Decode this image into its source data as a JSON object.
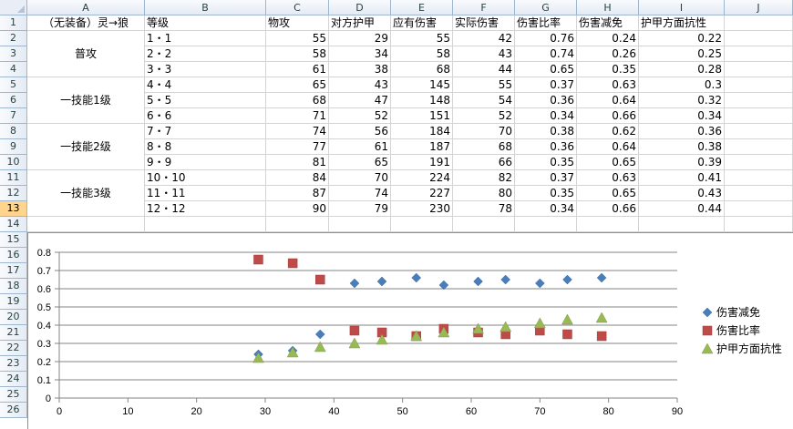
{
  "columns": [
    "A",
    "B",
    "C",
    "D",
    "E",
    "F",
    "G",
    "H",
    "I",
    "J"
  ],
  "rows": [
    "1",
    "2",
    "3",
    "4",
    "5",
    "6",
    "7",
    "8",
    "9",
    "10",
    "11",
    "12",
    "13",
    "14",
    "15",
    "16",
    "17",
    "18",
    "19",
    "20",
    "21",
    "22",
    "23",
    "24",
    "25",
    "26"
  ],
  "selected_row": "13",
  "header_row": [
    "（无装备）灵→狼",
    "等级",
    "物攻",
    "对方护甲",
    "应有伤害",
    "实际伤害",
    "伤害比率",
    "伤害减免",
    "护甲方面抗性"
  ],
  "groups": [
    "普攻",
    "一技能1级",
    "一技能2级",
    "一技能3级"
  ],
  "data_rows": [
    {
      "level": "1・1",
      "atk": "55",
      "armor": "29",
      "expected": "55",
      "actual": "42",
      "ratio": "0.76",
      "reduction": "0.24",
      "resist": "0.22"
    },
    {
      "level": "2・2",
      "atk": "58",
      "armor": "34",
      "expected": "58",
      "actual": "43",
      "ratio": "0.74",
      "reduction": "0.26",
      "resist": "0.25"
    },
    {
      "level": "3・3",
      "atk": "61",
      "armor": "38",
      "expected": "68",
      "actual": "44",
      "ratio": "0.65",
      "reduction": "0.35",
      "resist": "0.28"
    },
    {
      "level": "4・4",
      "atk": "65",
      "armor": "43",
      "expected": "145",
      "actual": "55",
      "ratio": "0.37",
      "reduction": "0.63",
      "resist": "0.3"
    },
    {
      "level": "5・5",
      "atk": "68",
      "armor": "47",
      "expected": "148",
      "actual": "54",
      "ratio": "0.36",
      "reduction": "0.64",
      "resist": "0.32"
    },
    {
      "level": "6・6",
      "atk": "71",
      "armor": "52",
      "expected": "151",
      "actual": "52",
      "ratio": "0.34",
      "reduction": "0.66",
      "resist": "0.34"
    },
    {
      "level": "7・7",
      "atk": "74",
      "armor": "56",
      "expected": "184",
      "actual": "70",
      "ratio": "0.38",
      "reduction": "0.62",
      "resist": "0.36"
    },
    {
      "level": "8・8",
      "atk": "77",
      "armor": "61",
      "expected": "187",
      "actual": "68",
      "ratio": "0.36",
      "reduction": "0.64",
      "resist": "0.38"
    },
    {
      "level": "9・9",
      "atk": "81",
      "armor": "65",
      "expected": "191",
      "actual": "66",
      "ratio": "0.35",
      "reduction": "0.65",
      "resist": "0.39"
    },
    {
      "level": "10・10",
      "atk": "84",
      "armor": "70",
      "expected": "224",
      "actual": "82",
      "ratio": "0.37",
      "reduction": "0.63",
      "resist": "0.41"
    },
    {
      "level": "11・11",
      "atk": "87",
      "armor": "74",
      "expected": "227",
      "actual": "80",
      "ratio": "0.35",
      "reduction": "0.65",
      "resist": "0.43"
    },
    {
      "level": "12・12",
      "atk": "90",
      "armor": "79",
      "expected": "230",
      "actual": "78",
      "ratio": "0.34",
      "reduction": "0.66",
      "resist": "0.44"
    }
  ],
  "chart_data": {
    "type": "scatter",
    "xlim": [
      0,
      90
    ],
    "ylim": [
      0,
      0.8
    ],
    "x_ticks": [
      "0",
      "10",
      "20",
      "30",
      "40",
      "50",
      "60",
      "70",
      "80",
      "90"
    ],
    "y_ticks": [
      "0",
      "0.1",
      "0.2",
      "0.3",
      "0.4",
      "0.5",
      "0.6",
      "0.7",
      "0.8"
    ],
    "grid": true,
    "legend_position": "right",
    "x": [
      29,
      34,
      38,
      43,
      47,
      52,
      56,
      61,
      65,
      70,
      74,
      79
    ],
    "series": [
      {
        "name": "伤害减免",
        "marker": "diamond",
        "color": "#4a7ebb",
        "values": [
          0.24,
          0.26,
          0.35,
          0.63,
          0.64,
          0.66,
          0.62,
          0.64,
          0.65,
          0.63,
          0.65,
          0.66
        ]
      },
      {
        "name": "伤害比率",
        "marker": "square",
        "color": "#be4b48",
        "values": [
          0.76,
          0.74,
          0.65,
          0.37,
          0.36,
          0.34,
          0.38,
          0.36,
          0.35,
          0.37,
          0.35,
          0.34
        ]
      },
      {
        "name": "护甲方面抗性",
        "marker": "triangle",
        "color": "#98b954",
        "values": [
          0.22,
          0.25,
          0.28,
          0.3,
          0.32,
          0.34,
          0.36,
          0.38,
          0.39,
          0.41,
          0.43,
          0.44
        ]
      }
    ]
  }
}
